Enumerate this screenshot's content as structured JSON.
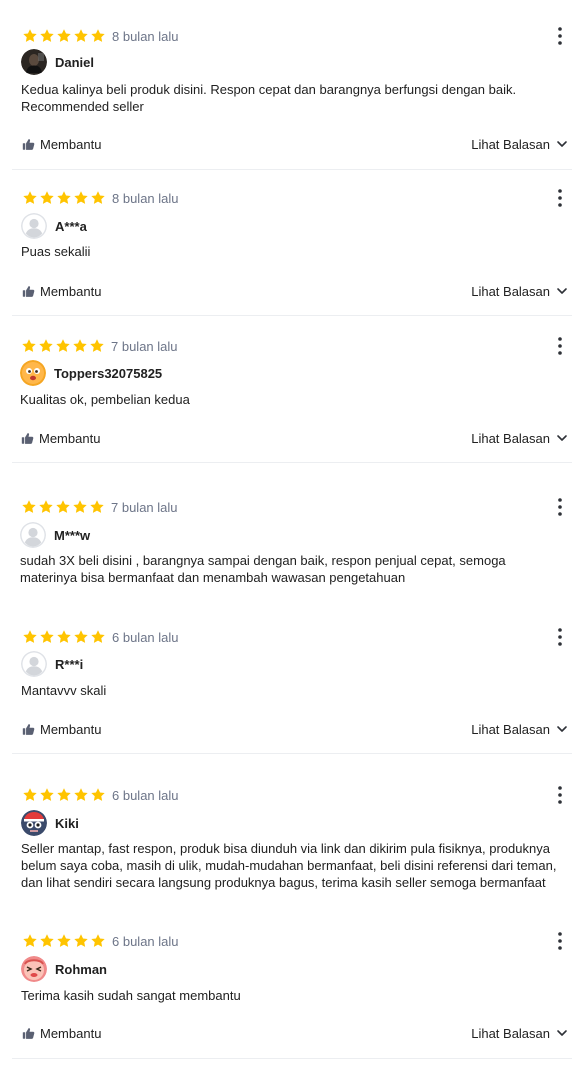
{
  "rating_color": "#ffc400",
  "reviews": [
    {
      "rating": 5,
      "time": "8 bulan lalu",
      "username": "Daniel",
      "avatar": "photo-dark",
      "text": "Kedua kalinya beli produk disini. Respon cepat dan barangnya berfungsi dengan baik. Recommended seller",
      "helpful_label": "Membantu",
      "replies_label": "Lihat Balasan"
    },
    {
      "rating": 5,
      "time": "8 bulan lalu",
      "username": "A***a",
      "avatar": "default-avatar",
      "text": "Puas sekalii",
      "helpful_label": "Membantu",
      "replies_label": "Lihat Balasan"
    },
    {
      "rating": 5,
      "time": "7 bulan lalu",
      "username": "Toppers32075825",
      "avatar": "orange-face",
      "text": "Kualitas ok, pembelian kedua",
      "helpful_label": "Membantu",
      "replies_label": "Lihat Balasan"
    },
    {
      "rating": 5,
      "time": "7 bulan lalu",
      "username": "M***w",
      "avatar": "default-avatar",
      "text": "sudah 3X beli disini , barangnya sampai dengan baik, respon penjual cepat, semoga materinya bisa bermanfaat dan menambah wawasan pengetahuan"
    },
    {
      "rating": 5,
      "time": "6 bulan lalu",
      "username": "R***i",
      "avatar": "default-avatar",
      "text": "Mantavvv skali",
      "helpful_label": "Membantu",
      "replies_label": "Lihat Balasan"
    },
    {
      "rating": 5,
      "time": "6 bulan lalu",
      "username": "Kiki",
      "avatar": "mascot-face",
      "text": "Seller mantap, fast respon, produk bisa diunduh via link dan dikirim pula fisiknya, produknya belum saya coba, masih di ulik, mudah-mudahan bermanfaat, beli disini referensi dari teman, dan lihat sendiri secara langsung produknya bagus, terima kasih seller semoga bermanfaat"
    },
    {
      "rating": 5,
      "time": "6 bulan lalu",
      "username": "Rohman",
      "avatar": "pink-face",
      "text": "Terima kasih sudah sangat membantu",
      "helpful_label": "Membantu",
      "replies_label": "Lihat Balasan"
    }
  ]
}
